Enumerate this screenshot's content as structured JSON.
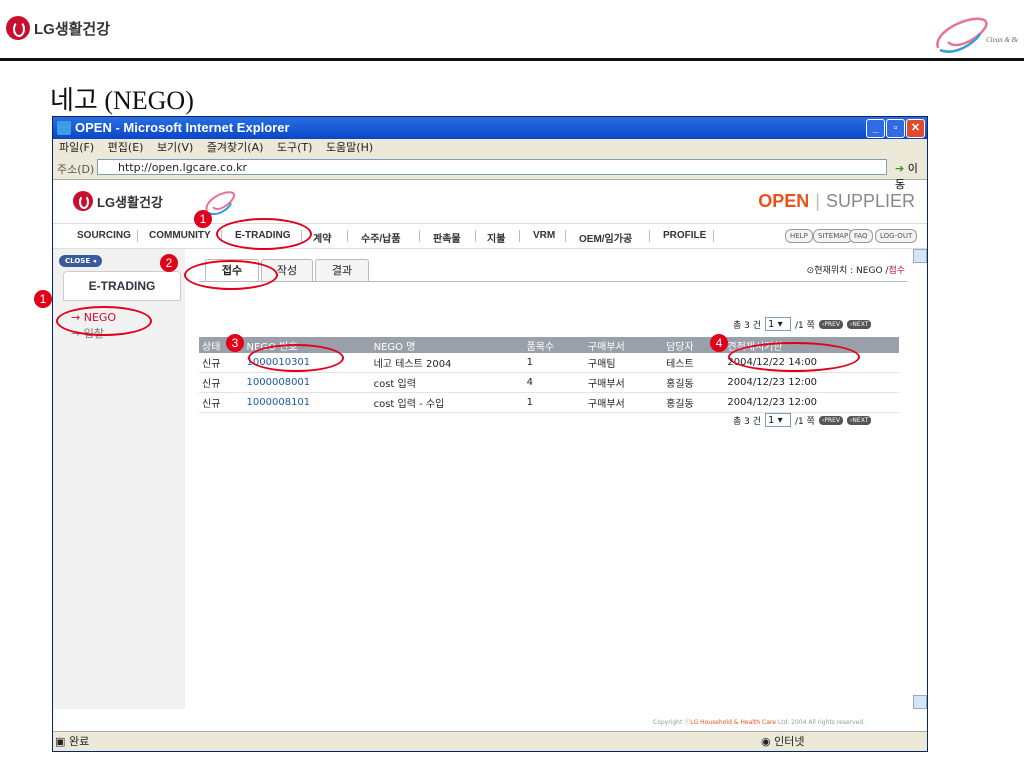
{
  "slide": {
    "logo_text": "LG생활건강",
    "corner_logo_text": "Clean & Beautiful",
    "title": "네고 (NEGO)"
  },
  "browser": {
    "title": "OPEN - Microsoft Internet Explorer",
    "menu": [
      "파일(F)",
      "편집(E)",
      "보기(V)",
      "즐겨찾기(A)",
      "도구(T)",
      "도움말(H)"
    ],
    "address_label": "주소(D)",
    "address": "http://open.lgcare.co.kr",
    "go_label": "이동",
    "status": "완료",
    "zone": "인터넷"
  },
  "page": {
    "logo_text": "LG생활건강",
    "brand_open": "OPEN",
    "brand_supplier": "SUPPLIER",
    "nav": [
      "SOURCING",
      "COMMUNITY",
      "E-TRADING",
      "계약",
      "수주/납품",
      "판촉물",
      "지불",
      "VRM",
      "OEM/임가공",
      "PROFILE"
    ],
    "util": [
      "HELP",
      "SITEMAP",
      "FAQ",
      "LOG-OUT"
    ],
    "close_label": "CLOSE",
    "section_tab": "E-TRADING",
    "left_links": [
      "NEGO",
      "입찰"
    ],
    "subtabs": [
      "접수",
      "작성",
      "결과"
    ],
    "location_prefix": "현재위치 : NEGO /",
    "location_current": "접수",
    "pager": {
      "total": "총 3 건",
      "page": "1",
      "unit": "/1 쪽",
      "prev": "PREV",
      "next": "NEXT"
    },
    "table": {
      "headers": [
        "상태",
        "NEGO 번호",
        "NEGO 명",
        "품목수",
        "구매부서",
        "담당자",
        "견적제시기한"
      ],
      "rows": [
        [
          "신규",
          "1000010301",
          "네고 테스트 2004",
          "1",
          "구매팀",
          "테스트",
          "2004/12/22 14:00"
        ],
        [
          "신규",
          "1000008001",
          "cost 입력",
          "4",
          "구매부서",
          "홍길동",
          "2004/12/23 12:00"
        ],
        [
          "신규",
          "1000008101",
          "cost 입력 - 수입",
          "1",
          "구매부서",
          "홍길동",
          "2004/12/23 12:00"
        ]
      ]
    },
    "copyright_prefix": "Copyright",
    "copyright_lg": "LG Household & Health Care",
    "copyright_suffix": "Ltd. 2004 All rights reserved."
  },
  "annotations": [
    "1",
    "2",
    "3",
    "4",
    "1"
  ],
  "colors": {
    "accent": "#e0001a",
    "brand_orange": "#e8531b",
    "titlebar": "#0a46c8"
  }
}
